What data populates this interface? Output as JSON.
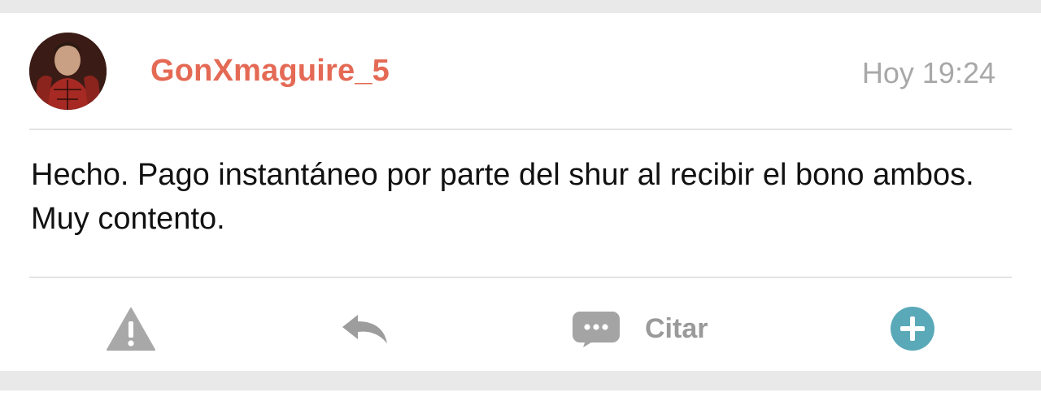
{
  "post": {
    "username": "GonXmaguire_5",
    "timestamp": "Hoy 19:24",
    "message": "Hecho. Pago instantáneo por parte del shur al recibir el bono ambos. Muy contento.",
    "avatar_icon": "user-avatar",
    "accent_color": "#e46a55"
  },
  "actions": {
    "report_icon": "warning-icon",
    "reply_icon": "reply-arrow-icon",
    "quote_icon": "speech-bubble-icon",
    "quote_label": "Citar",
    "plus_icon": "plus-circle-icon",
    "plus_color": "#5aa9b9"
  }
}
